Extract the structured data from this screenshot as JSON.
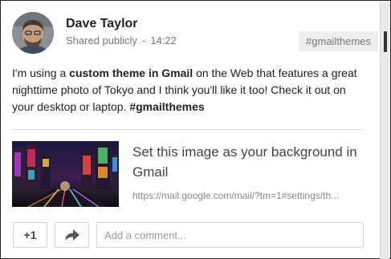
{
  "post": {
    "author_name": "Dave Taylor",
    "visibility": "Shared publicly",
    "separator": "-",
    "time": "14:22",
    "hashtag_chip": "#gmailthemes",
    "text_parts": {
      "p1": "I'm using a ",
      "p2": "custom theme in Gmail",
      "p3": " on the Web that features a great nighttime photo of Tokyo and I think you'll like it too! Check it out on your desktop or laptop. ",
      "p4": "#gmailthemes"
    }
  },
  "link_preview": {
    "title": "Set this image as your background in Gmail",
    "url": "https://mail.google.com/mail/?tm=1#settings/th..."
  },
  "actions": {
    "plus_one_label": "+1",
    "share_icon": "share-arrow-icon",
    "comment_placeholder": "Add a comment..."
  }
}
